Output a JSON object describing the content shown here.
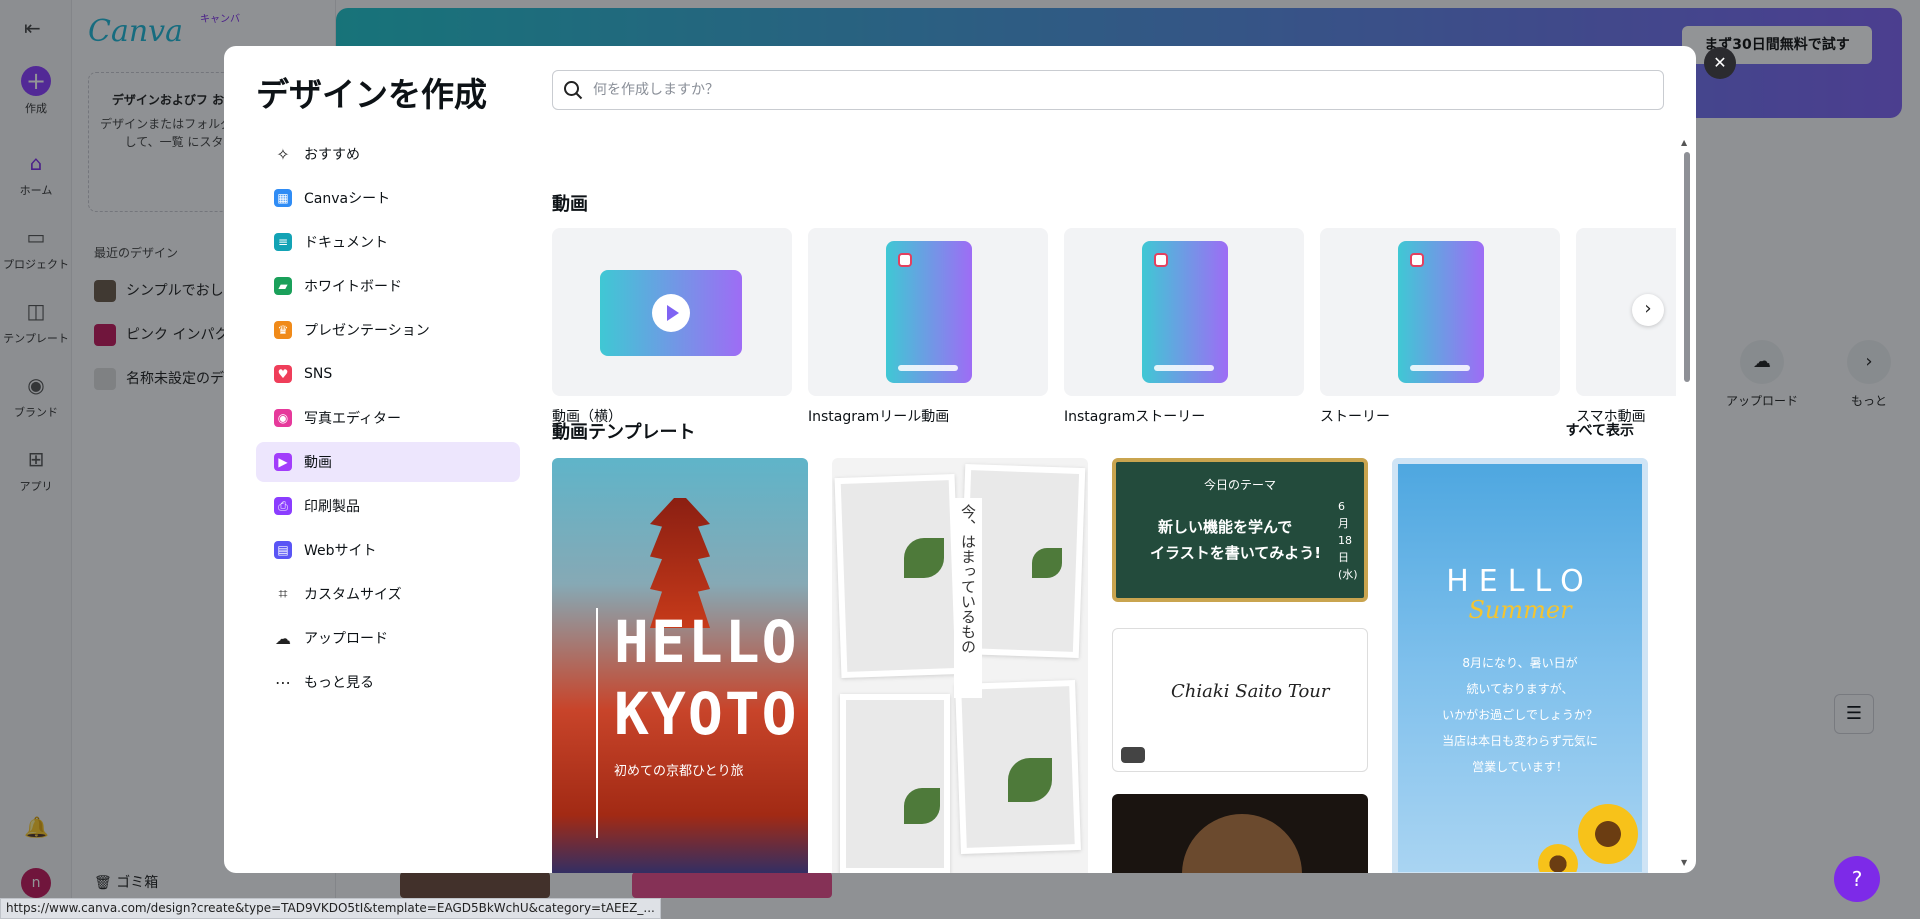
{
  "background": {
    "logo": "Canva",
    "logo_kana": "キャンバ",
    "rail": [
      {
        "label": "作成"
      },
      {
        "label": "ホーム"
      },
      {
        "label": "プロジェクト"
      },
      {
        "label": "テンプレート"
      },
      {
        "label": "ブランド"
      },
      {
        "label": "アプリ"
      }
    ],
    "user_initial": "n",
    "hint_title": "デザインおよびフ お気に入りに追",
    "hint_body": "デザインまたはフォルダ イコンを選択して、一覧 にスターを付けま",
    "recent_title": "最近のデザイン",
    "recent_items": [
      {
        "label": "シンプルでおし"
      },
      {
        "label": "ピンク インパク"
      },
      {
        "label": "名称未設定のデ"
      }
    ],
    "trash": "ゴミ箱",
    "trial_button": "まず30日間無料で試す",
    "upload_label": "アップロード",
    "more_label": "もっと"
  },
  "status_url": "https://www.canva.com/design?create&type=TAD9VKDO5tI&template=EAGD5BkWchU&category=tAEEZ_...",
  "modal": {
    "title": "デザインを作成",
    "search_placeholder": "何を作成しますか？",
    "nav": [
      {
        "label": "おすすめ",
        "icon": "sparkle-icon",
        "color": "#222222"
      },
      {
        "label": "Canvaシート",
        "icon": "sheet-icon",
        "color": "#2f8cf5"
      },
      {
        "label": "ドキュメント",
        "icon": "doc-icon",
        "color": "#13a3b5"
      },
      {
        "label": "ホワイトボード",
        "icon": "whiteboard-icon",
        "color": "#1aa05a"
      },
      {
        "label": "プレゼンテーション",
        "icon": "presentation-icon",
        "color": "#f08a19"
      },
      {
        "label": "SNS",
        "icon": "heart-icon",
        "color": "#ef3e5a"
      },
      {
        "label": "写真エディター",
        "icon": "camera-icon",
        "color": "#e6399b"
      },
      {
        "label": "動画",
        "icon": "video-icon",
        "color": "#a23dfb",
        "active": true
      },
      {
        "label": "印刷製品",
        "icon": "printer-icon",
        "color": "#8b3dff"
      },
      {
        "label": "Webサイト",
        "icon": "browser-icon",
        "color": "#5a55f5"
      },
      {
        "label": "カスタムサイズ",
        "icon": "resize-icon",
        "color": "#222222"
      },
      {
        "label": "アップロード",
        "icon": "cloud-upload-icon",
        "color": "#222222"
      },
      {
        "label": "もっと見る",
        "icon": "more-icon",
        "color": "#222222"
      }
    ],
    "video_section": {
      "title": "動画",
      "cards": [
        {
          "label": "動画（横）",
          "kind": "landscape"
        },
        {
          "label": "Instagramリール動画",
          "kind": "portrait"
        },
        {
          "label": "Instagramストーリー",
          "kind": "portrait"
        },
        {
          "label": "ストーリー",
          "kind": "portrait"
        },
        {
          "label": "スマホ動画",
          "kind": "blank"
        }
      ]
    },
    "template_section": {
      "title": "動画テンプレート",
      "see_all": "すべて表示",
      "kyoto": {
        "line1": "HELLO",
        "line2": "KYOTO",
        "sub": "初めての京都ひとり旅"
      },
      "plants": {
        "vertical_text": "今、はまっているもの"
      },
      "chalk": {
        "theme": "今日のテーマ",
        "line1": "新しい機能を学んで",
        "line2": "イラストを書いてみよう!",
        "date": "6月18日(水)"
      },
      "sign": {
        "text": "Chiaki Saito Tour"
      },
      "summer": {
        "hello": "HELLO",
        "summer": "Summer",
        "body": [
          "8月になり、暑い日が",
          "続いておりますが、",
          "いかがお過ごしでしょうか？",
          "当店は本日も変わらず元気に",
          "営業しています！"
        ]
      }
    }
  }
}
